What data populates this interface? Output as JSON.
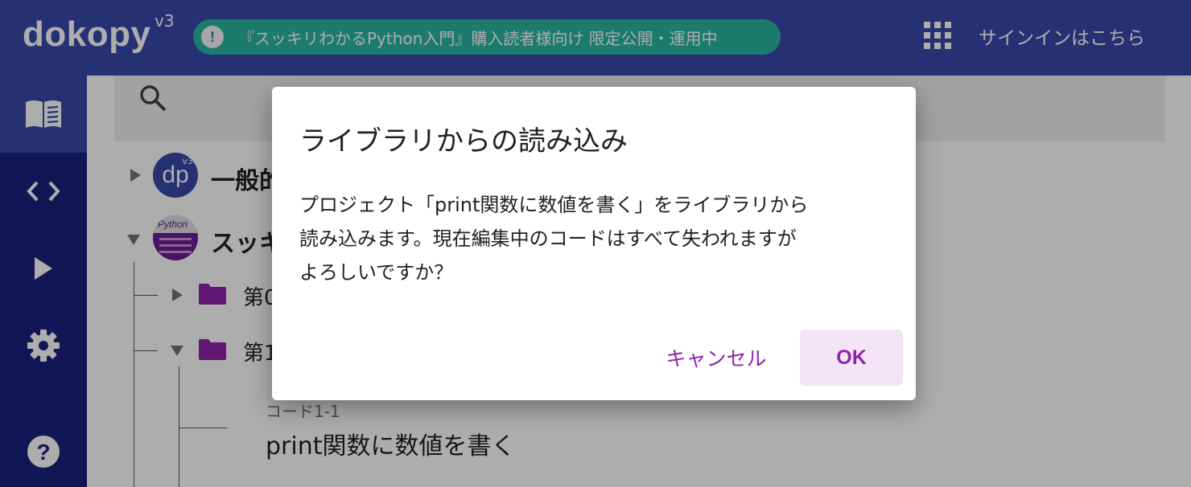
{
  "header": {
    "logo": "dokopy",
    "logo_version": "v3",
    "notice_icon_glyph": "!",
    "notice_text": "『スッキリわかるPython入門』購入読者様向け 限定公開・運用中",
    "signin_label": "サインインはこちら",
    "icons": {
      "apps": "apps-grid-icon",
      "notice": "info-circle-icon"
    }
  },
  "sidebar": {
    "items": [
      {
        "name": "library",
        "icon": "book-icon",
        "active": true
      },
      {
        "name": "code",
        "icon": "code-brackets-icon",
        "active": false
      },
      {
        "name": "run",
        "icon": "play-icon",
        "active": false
      },
      {
        "name": "settings",
        "icon": "gear-icon",
        "active": false
      },
      {
        "name": "help",
        "icon": "help-circle-icon",
        "active": false
      }
    ]
  },
  "library": {
    "search_icon": "search-icon",
    "nodes": [
      {
        "label": "一般的",
        "avatar_text": "dp",
        "avatar_badge": "v3",
        "expanded": false
      },
      {
        "label": "スッキ",
        "avatar_text": "Python",
        "expanded": true
      }
    ],
    "folders": [
      {
        "label": "第0",
        "expanded": false
      },
      {
        "label": "第1",
        "expanded": true
      }
    ],
    "code_item": {
      "caption": "コード1-1",
      "title": "print関数に数値を書く"
    }
  },
  "dialog": {
    "title": "ライブラリからの読み込み",
    "body_lines": [
      "プロジェクト「print関数に数値を書く」をライブラリから",
      "読み込みます。現在編集中のコードはすべて失われますが",
      "よろしいですか？"
    ],
    "cancel_label": "キャンセル",
    "ok_label": "OK"
  },
  "colors": {
    "appbar": "#3949ab",
    "rail": "#1a237e",
    "notice": "#2bb6a3",
    "accent": "#8e24aa",
    "folder": "#8e24aa"
  }
}
